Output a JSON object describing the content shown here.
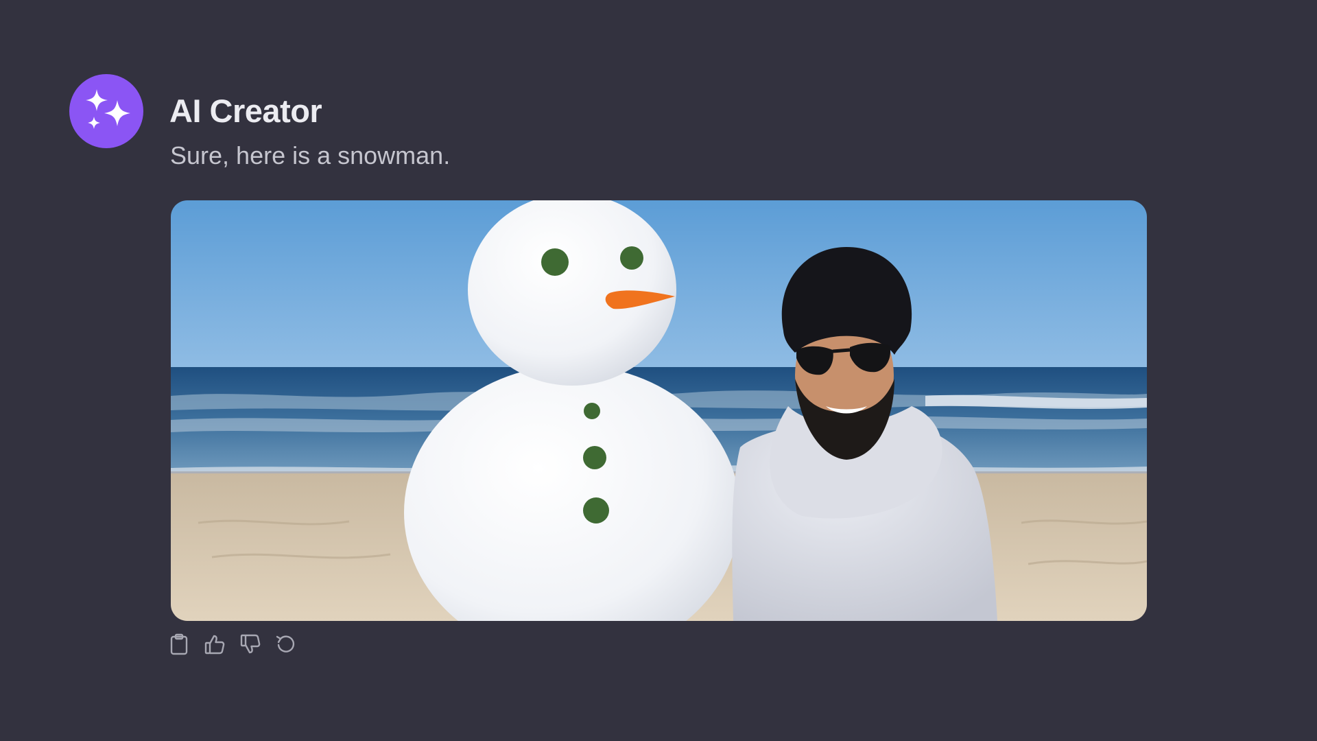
{
  "message": {
    "sender": "AI Creator",
    "text": "Sure, here is a snowman.",
    "image": {
      "subject": "snowman on beach with man in black beanie and sunglasses"
    },
    "actions": [
      {
        "icon": "clipboard-icon",
        "label": "Copy"
      },
      {
        "icon": "thumbs-up-icon",
        "label": "Good response"
      },
      {
        "icon": "thumbs-down-icon",
        "label": "Bad response"
      },
      {
        "icon": "regenerate-icon",
        "label": "Regenerate"
      }
    ]
  },
  "colors": {
    "background": "#33323f",
    "avatar": "#8b55f4",
    "sender_text": "#ececf1",
    "message_text": "#c6c6cf",
    "action_icons": "#a8a8b3"
  }
}
